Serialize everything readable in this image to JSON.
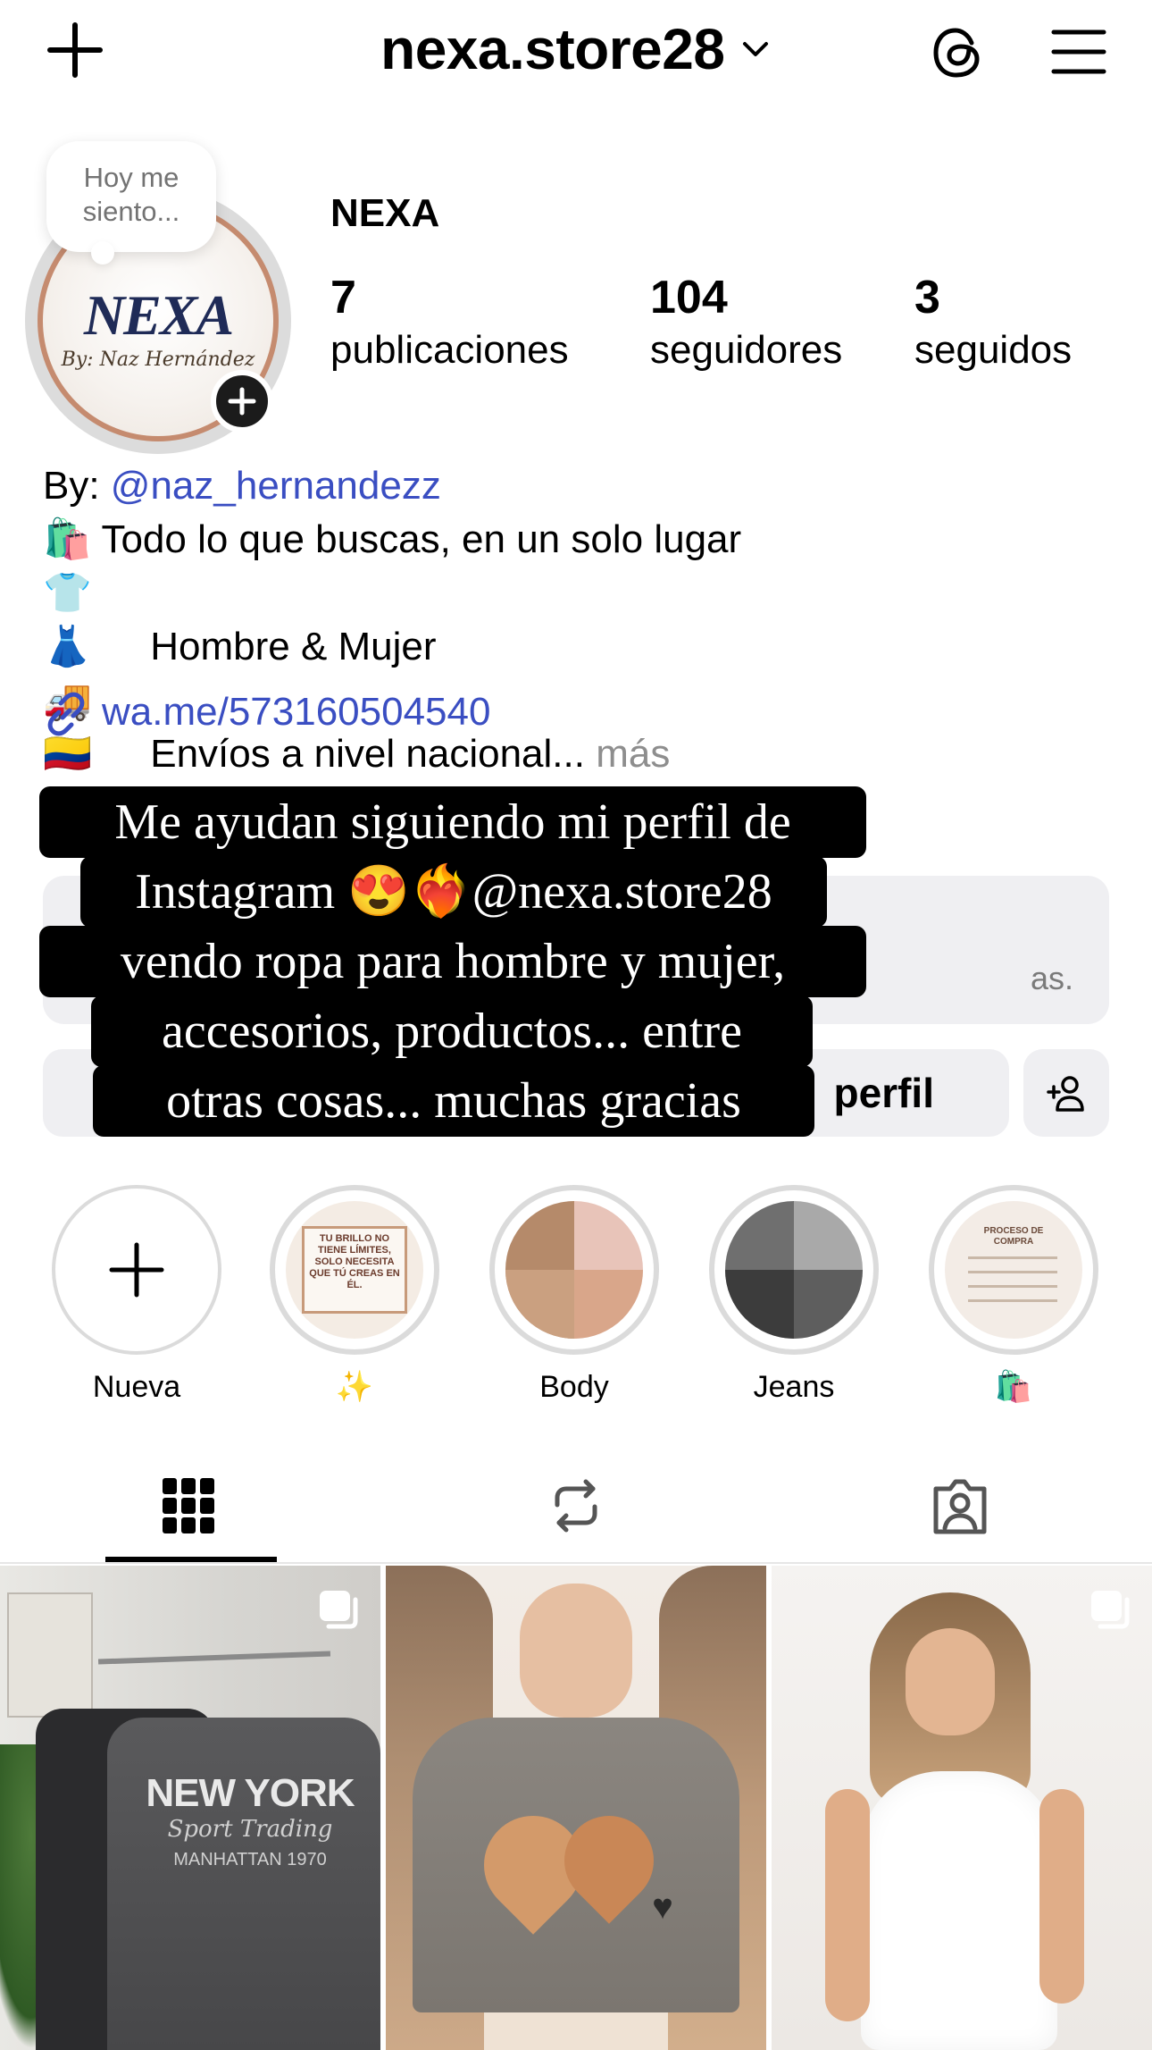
{
  "header": {
    "username": "nexa.store28"
  },
  "profile": {
    "note": "Hoy me siento...",
    "display_name": "NEXA",
    "avatar_logo_main": "NEXA",
    "avatar_logo_sub": "By: Naz Hernández",
    "stats": {
      "posts_count": "7",
      "posts_label": "publicaciones",
      "followers_count": "104",
      "followers_label": "seguidores",
      "following_count": "3",
      "following_label": "seguidos"
    },
    "bio": {
      "line1_prefix": "By: ",
      "line1_mention": "@naz_hernandezz",
      "line2_emoji": "🛍️",
      "line2_text": "Todo lo que buscas, en un solo lugar",
      "line3_emoji": "👕👗",
      "line3_text": "Hombre & Mujer",
      "line4_emoji": "🚚🇨🇴",
      "line4_text": "Envíos a nivel nacional...",
      "more": "más"
    },
    "link": "wa.me/573160504540"
  },
  "partial_ui": {
    "pro_hint": "as.",
    "share_profile_fragment": "perfil"
  },
  "overlay_text": {
    "line1": "Me ayudan siguiendo mi perfil de",
    "line2": "Instagram 😍❤️‍🔥@nexa.store28",
    "line3": "vendo ropa para hombre y mujer,",
    "line4": "accesorios, productos... entre",
    "line5": "otras cosas... muchas gracias"
  },
  "highlights": [
    {
      "label": "Nueva"
    },
    {
      "label": "✨",
      "cover_text": "TU BRILLO NO TIENE LÍMITES, SOLO NECESITA QUE TÚ CREAS EN ÉL."
    },
    {
      "label": "Body"
    },
    {
      "label": "Jeans"
    },
    {
      "label": "🛍️",
      "cover_text": "PROCESO DE COMPRA"
    }
  ],
  "posts": [
    {
      "print": "NEW YORK",
      "subprint": "Sport Trading",
      "subprint2": "MANHATTAN 1970"
    },
    {
      "print": "♥"
    },
    {
      "print": ""
    }
  ],
  "colors": {
    "link_blue": "#3a4ec2",
    "secondary_gray": "#8e8e8e",
    "button_bg": "#efeff2"
  }
}
